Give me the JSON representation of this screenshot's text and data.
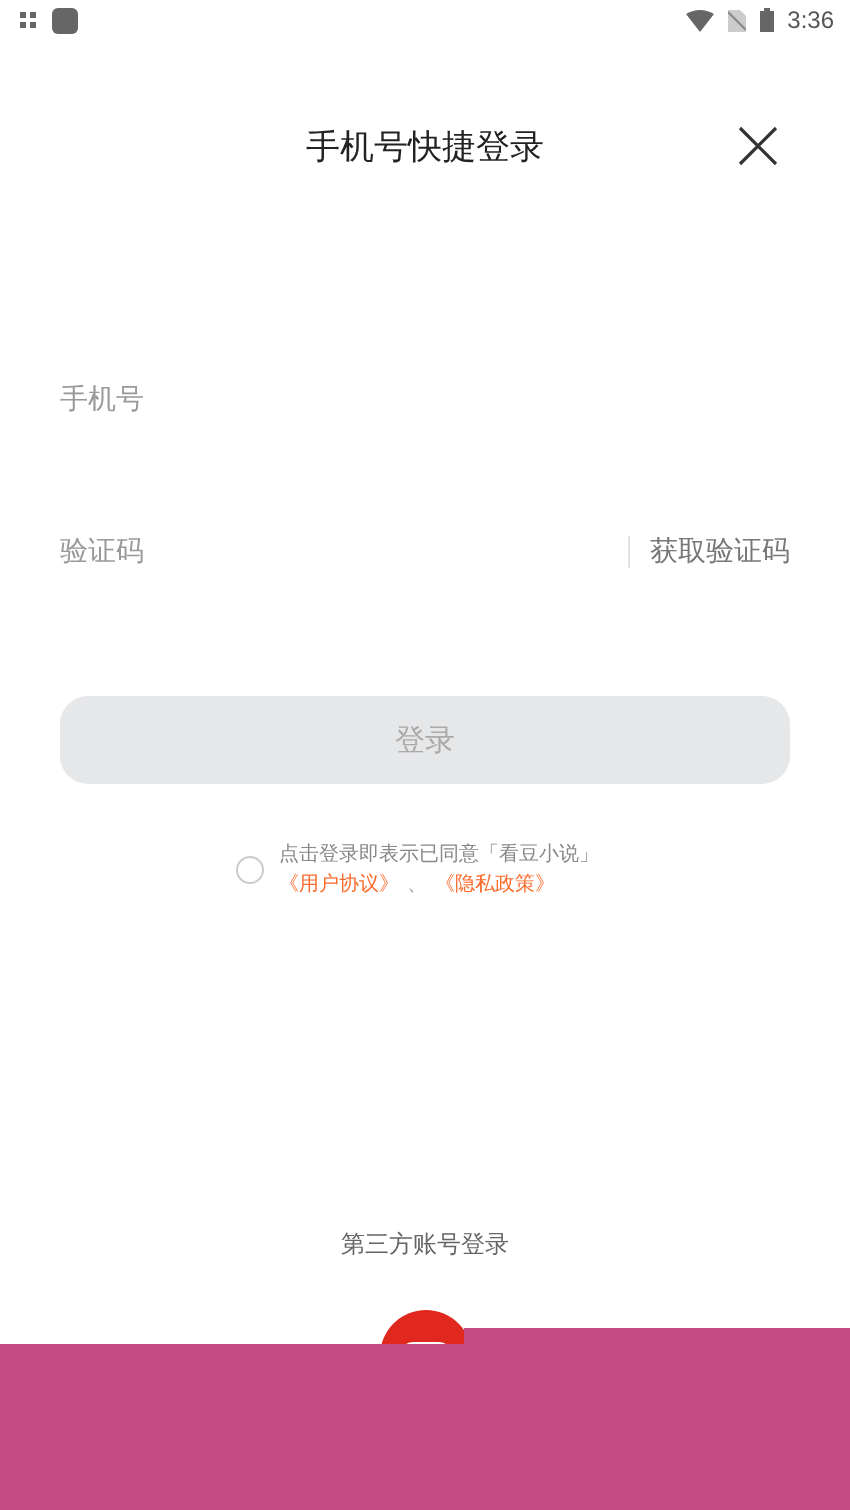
{
  "status_bar": {
    "time": "3:36"
  },
  "header": {
    "title": "手机号快捷登录"
  },
  "phone_field": {
    "placeholder": "手机号"
  },
  "code_field": {
    "placeholder": "验证码",
    "action": "获取验证码"
  },
  "login_button": {
    "label": "登录",
    "disabled": true
  },
  "agreement": {
    "checked": false,
    "text": "点击登录即表示已同意「看豆小说」",
    "links": [
      "《用户协议》",
      "《隐私政策》"
    ],
    "separator": "、"
  },
  "third_party": {
    "label": "第三方账号登录"
  }
}
